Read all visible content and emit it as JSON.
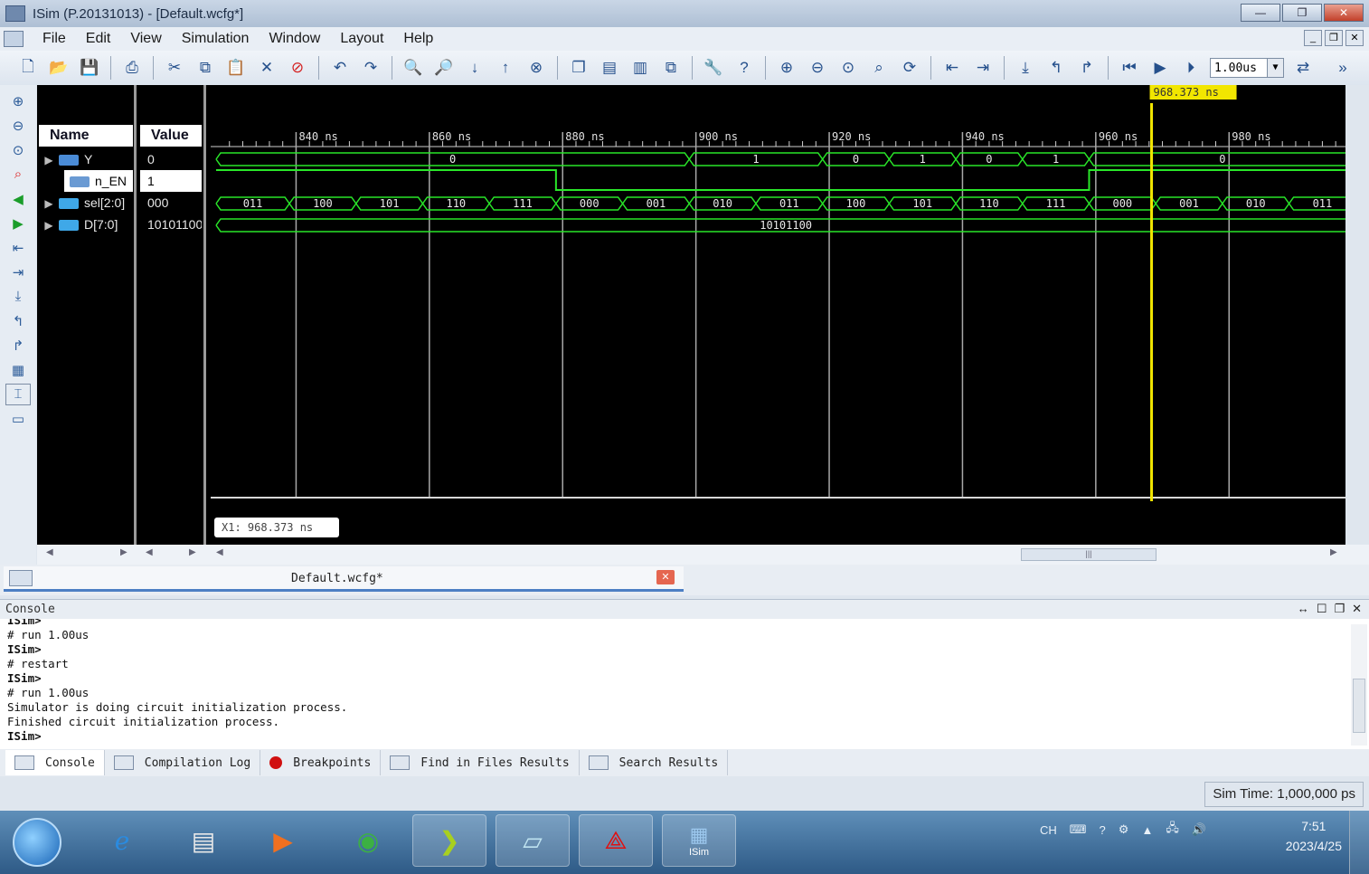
{
  "window": {
    "title": "ISim (P.20131013) - [Default.wcfg*]",
    "min": "—",
    "max": "❐",
    "close": "✕"
  },
  "menu": [
    "File",
    "Edit",
    "View",
    "Simulation",
    "Window",
    "Layout",
    "Help"
  ],
  "mdi": {
    "min": "_",
    "restore": "❐",
    "close": "✕"
  },
  "toolbar": {
    "run_time": "1.00us"
  },
  "signals": {
    "name_header": "Name",
    "value_header": "Value",
    "rows": [
      {
        "name": "Y",
        "value": "0",
        "expander": "▶"
      },
      {
        "name": "n_EN",
        "value": "1",
        "expander": ""
      },
      {
        "name": "sel[2:0]",
        "value": "000",
        "expander": "▶"
      },
      {
        "name": "D[7:0]",
        "value": "10101100",
        "expander": "▶"
      }
    ]
  },
  "waveform": {
    "time_unit": "ns",
    "view_start": 828,
    "view_end": 999,
    "tick_labels": [
      "840 ns",
      "860 ns",
      "880 ns",
      "900 ns",
      "920 ns",
      "940 ns",
      "960 ns",
      "980 ns"
    ],
    "cursor": {
      "time": 968.373,
      "label": "968.373 ns",
      "readout": "X1: 968.373 ns"
    },
    "Y": [
      {
        "from": 828,
        "to": 899,
        "value": "0"
      },
      {
        "from": 899,
        "to": 919,
        "value": "1"
      },
      {
        "from": 919,
        "to": 929,
        "value": "0"
      },
      {
        "from": 929,
        "to": 939,
        "value": "1"
      },
      {
        "from": 939,
        "to": 949,
        "value": "0"
      },
      {
        "from": 949,
        "to": 959,
        "value": "1"
      },
      {
        "from": 959,
        "to": 999,
        "value": "0"
      }
    ],
    "n_EN": [
      {
        "from": 828,
        "to": 879,
        "level": 1
      },
      {
        "from": 879,
        "to": 959,
        "level": 0
      },
      {
        "from": 959,
        "to": 999,
        "level": 1
      }
    ],
    "sel": [
      {
        "from": 828,
        "to": 839,
        "value": "011"
      },
      {
        "from": 839,
        "to": 849,
        "value": "100"
      },
      {
        "from": 849,
        "to": 859,
        "value": "101"
      },
      {
        "from": 859,
        "to": 869,
        "value": "110"
      },
      {
        "from": 869,
        "to": 879,
        "value": "111"
      },
      {
        "from": 879,
        "to": 889,
        "value": "000"
      },
      {
        "from": 889,
        "to": 899,
        "value": "001"
      },
      {
        "from": 899,
        "to": 909,
        "value": "010"
      },
      {
        "from": 909,
        "to": 919,
        "value": "011"
      },
      {
        "from": 919,
        "to": 929,
        "value": "100"
      },
      {
        "from": 929,
        "to": 939,
        "value": "101"
      },
      {
        "from": 939,
        "to": 949,
        "value": "110"
      },
      {
        "from": 949,
        "to": 959,
        "value": "111"
      },
      {
        "from": 959,
        "to": 969,
        "value": "000"
      },
      {
        "from": 969,
        "to": 979,
        "value": "001"
      },
      {
        "from": 979,
        "to": 989,
        "value": "010"
      },
      {
        "from": 989,
        "to": 999,
        "value": "011"
      }
    ],
    "D": [
      {
        "from": 828,
        "to": 999,
        "value": "10101100"
      }
    ]
  },
  "doc_tab": {
    "label": "Default.wcfg*",
    "close": "✕"
  },
  "console": {
    "title": "Console",
    "controls": [
      "↔",
      "☐",
      "❐",
      "✕"
    ],
    "lines": [
      "ISim>",
      "# run 1.00us",
      "ISim>",
      "# restart",
      "ISim>",
      "# run 1.00us",
      "Simulator is doing circuit initialization process.",
      "Finished circuit initialization process.",
      "ISim>"
    ]
  },
  "bottom_tabs": [
    "Console",
    "Compilation Log",
    "Breakpoints",
    "Find in Files Results",
    "Search Results"
  ],
  "status": {
    "sim_time": "Sim Time: 1,000,000 ps"
  },
  "taskbar": {
    "lang": "CH",
    "time": "7:51",
    "date": "2023/4/25",
    "isim_label": "ISim"
  },
  "colors": {
    "wave": "#29e629",
    "cursor": "#f2e600",
    "grid": "#a8a8a8",
    "bg": "#000000"
  }
}
